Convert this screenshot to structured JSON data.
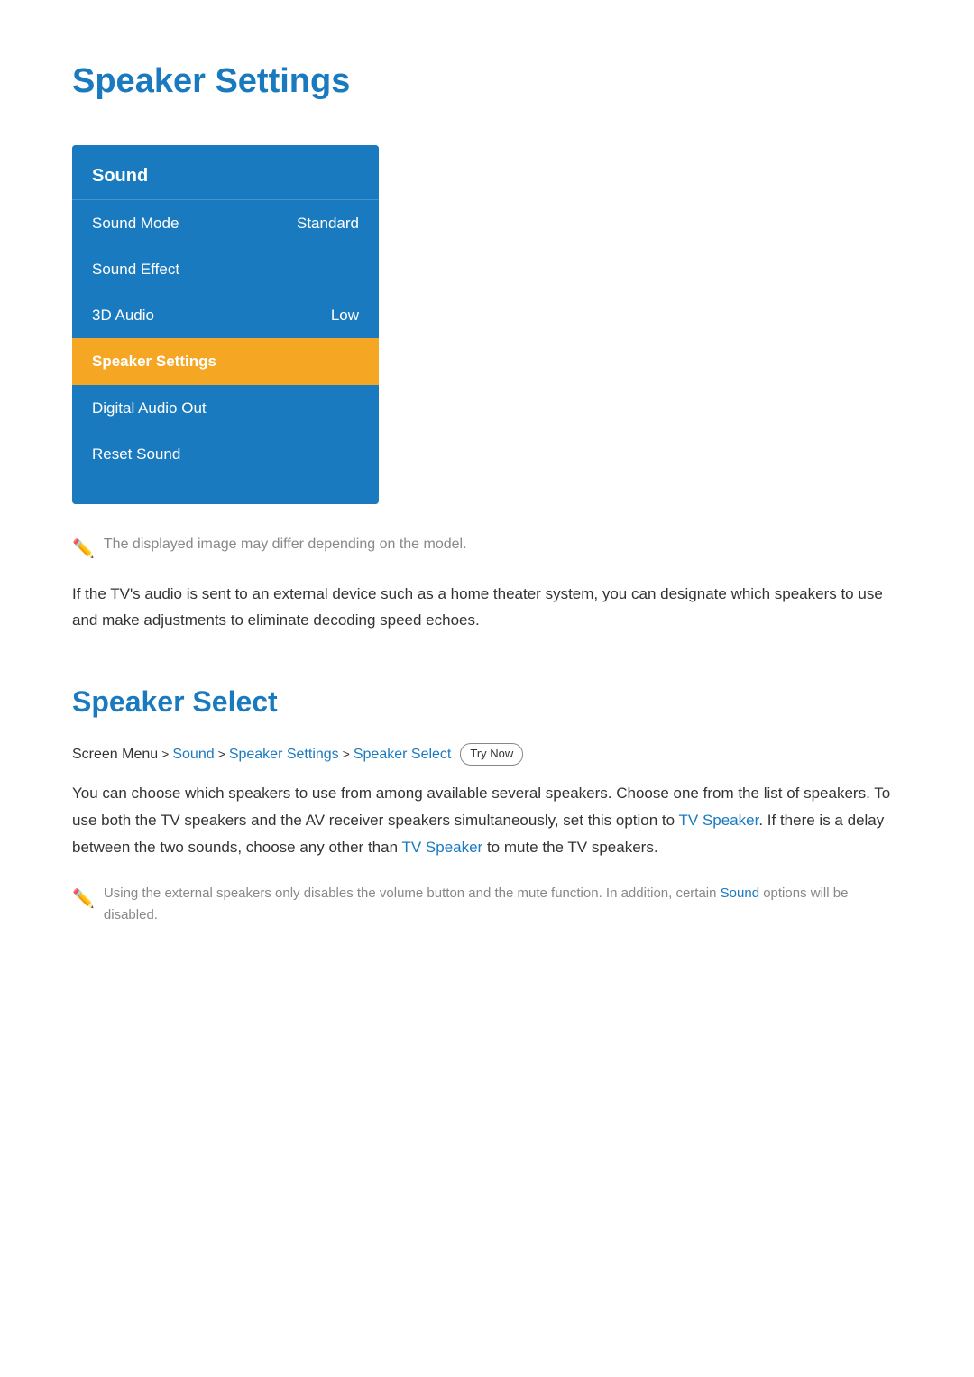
{
  "page": {
    "title": "Speaker Settings",
    "description": "If the TV's audio is sent to an external device such as a home theater system, you can designate which speakers to use and make adjustments to eliminate decoding speed echoes."
  },
  "menu": {
    "header": "Sound",
    "items": [
      {
        "label": "Sound Mode",
        "value": "Standard",
        "highlighted": false
      },
      {
        "label": "Sound Effect",
        "value": "",
        "highlighted": false
      },
      {
        "label": "3D Audio",
        "value": "Low",
        "highlighted": false
      },
      {
        "label": "Speaker Settings",
        "value": "",
        "highlighted": true
      },
      {
        "label": "Digital Audio Out",
        "value": "",
        "highlighted": false
      },
      {
        "label": "Reset Sound",
        "value": "",
        "highlighted": false
      }
    ]
  },
  "menu_note": "The displayed image may differ depending on the model.",
  "speaker_select": {
    "title": "Speaker Select",
    "breadcrumb": {
      "parts": [
        {
          "text": "Screen Menu",
          "type": "plain"
        },
        {
          "text": ">",
          "type": "chevron"
        },
        {
          "text": "Sound",
          "type": "link"
        },
        {
          "text": ">",
          "type": "chevron"
        },
        {
          "text": "Speaker Settings",
          "type": "link"
        },
        {
          "text": ">",
          "type": "chevron"
        },
        {
          "text": "Speaker Select",
          "type": "link"
        }
      ],
      "try_now": "Try Now"
    },
    "body": "You can choose which speakers to use from among available several speakers. Choose one from the list of speakers. To use both the TV speakers and the AV receiver speakers simultaneously, set this option to TV Speaker. If there is a delay between the two sounds, choose any other than TV Speaker to mute the TV speakers.",
    "body_links": {
      "tv_speaker": "TV Speaker"
    },
    "note": "Using the external speakers only disables the volume button and the mute function. In addition, certain Sound options will be disabled."
  },
  "colors": {
    "blue": "#1a7abf",
    "highlight_orange": "#f5a623",
    "gray": "#888888"
  }
}
